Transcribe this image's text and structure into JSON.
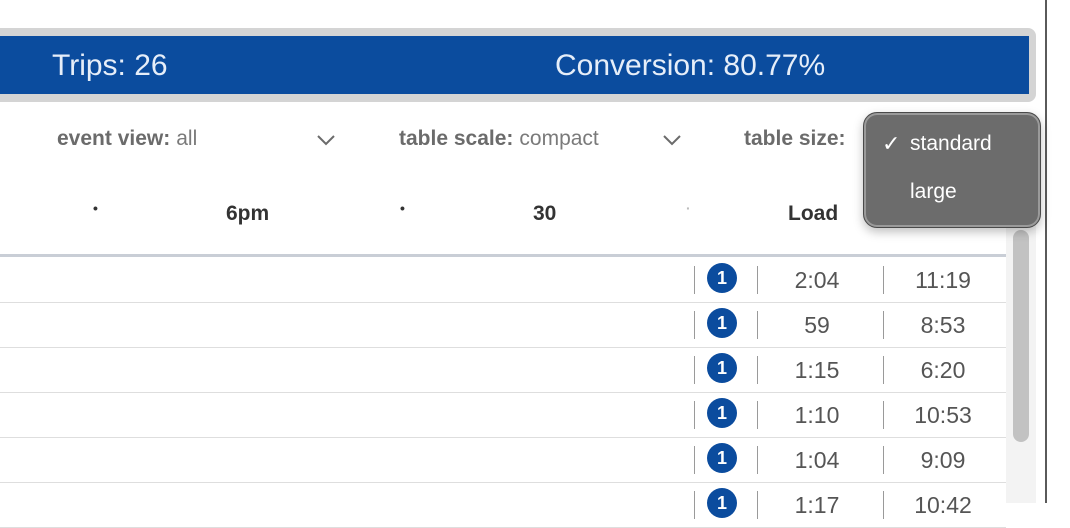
{
  "banner": {
    "trips": "Trips: 26",
    "conversion": "Conversion: 80.77%",
    "color": "#0b4c9e"
  },
  "filters": {
    "event_view": {
      "label": "event view:",
      "value": "all"
    },
    "table_scale": {
      "label": "table scale:",
      "value": "compact"
    },
    "table_size": {
      "label": "table size:"
    }
  },
  "table": {
    "header": {
      "dot1": "•",
      "col_6pm": "6pm",
      "dot2": "•",
      "col_30": "30",
      "dot3": "·",
      "col_load": "Load"
    },
    "rows": [
      {
        "badge": "1",
        "load": "2:04",
        "time": "11:19"
      },
      {
        "badge": "1",
        "load": "59",
        "time": "8:53"
      },
      {
        "badge": "1",
        "load": "1:15",
        "time": "6:20"
      },
      {
        "badge": "1",
        "load": "1:10",
        "time": "10:53"
      },
      {
        "badge": "1",
        "load": "1:04",
        "time": "9:09"
      },
      {
        "badge": "1",
        "load": "1:17",
        "time": "10:42"
      }
    ]
  },
  "dropdown": {
    "selected_mark": "✓",
    "options": [
      "standard",
      "large"
    ],
    "selected": "standard"
  }
}
